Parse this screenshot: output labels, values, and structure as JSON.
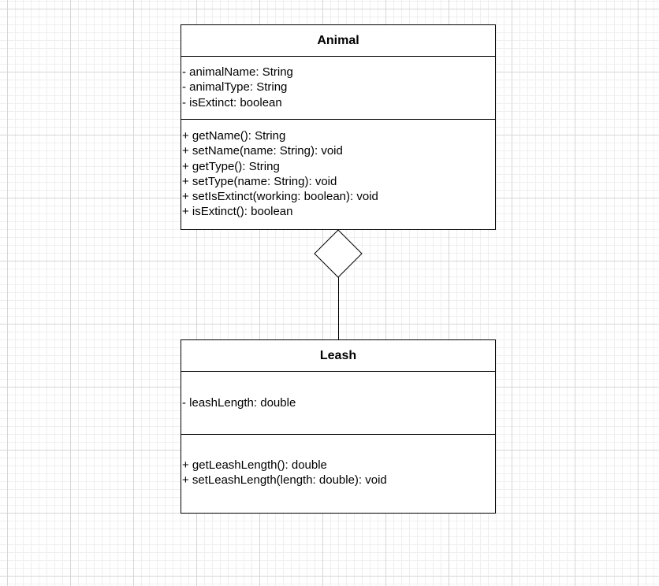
{
  "classes": {
    "animal": {
      "name": "Animal",
      "attributes": [
        "- animalName: String",
        "- animalType: String",
        "- isExtinct: boolean"
      ],
      "methods": [
        "+ getName(): String",
        "+ setName(name: String): void",
        "+ getType(): String",
        "+ setType(name: String): void",
        "+ setIsExtinct(working: boolean): void",
        "+ isExtinct(): boolean"
      ]
    },
    "leash": {
      "name": "Leash",
      "attributes": [
        "- leashLength: double"
      ],
      "methods": [
        "+ getLeashLength(): double",
        "+ setLeashLength(length: double): void"
      ]
    }
  },
  "relationship": {
    "type": "aggregation",
    "whole": "Animal",
    "part": "Leash"
  }
}
